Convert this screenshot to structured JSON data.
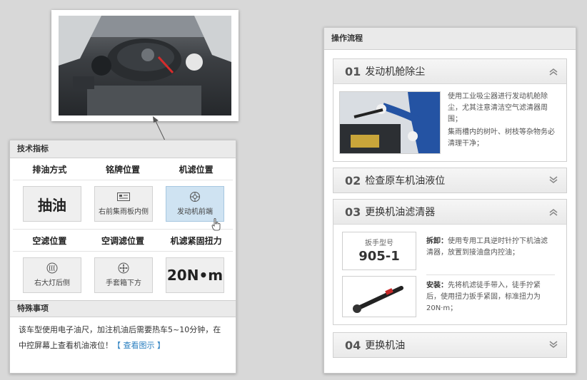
{
  "tech_panel": {
    "title": "技术指标",
    "row1_labels": [
      "排油方式",
      "铭牌位置",
      "机滤位置"
    ],
    "row1_tiles": [
      {
        "text": "抽油",
        "icon": ""
      },
      {
        "text": "右前集雨板内侧",
        "icon": "nameplate-icon"
      },
      {
        "text": "发动机前端",
        "icon": "engine-gear-icon"
      }
    ],
    "row2_labels": [
      "空滤位置",
      "空调滤位置",
      "机滤紧固扭力"
    ],
    "row2_tiles": [
      {
        "text": "右大灯后侧",
        "icon": "air-filter-icon"
      },
      {
        "text": "手套箱下方",
        "icon": "fan-icon"
      },
      {
        "text": "20N•m",
        "icon": ""
      }
    ],
    "special_title": "特殊事项",
    "special_text": "该车型使用电子油尺，加注机油后需要热车5~10分钟，在中控屏幕上查看机油液位！",
    "special_link": "【 查看图示 】"
  },
  "process_panel": {
    "title": "操作流程",
    "steps": [
      {
        "num": "01",
        "title": "发动机舱除尘",
        "expanded": true,
        "text1": "使用工业吸尘器进行发动机舱除尘，尤其注意清洁空气滤清器周围；",
        "text2": "集雨槽内的树叶、树枝等杂物务必清理干净；"
      },
      {
        "num": "02",
        "title": "检查原车机油液位",
        "expanded": false
      },
      {
        "num": "03",
        "title": "更换机油滤清器",
        "expanded": true,
        "wrench_label": "扳手型号",
        "wrench_model": "905-1",
        "remove_label": "拆卸：",
        "remove_text": "使用专用工具逆时针拧下机油滤清器，放置到接油盘内控油；",
        "install_label": "安装：",
        "install_text": "先将机滤徒手带入，徒手拧紧后，使用扭力扳手紧固，标准扭力为20N·m；"
      },
      {
        "num": "04",
        "title": "更换机油",
        "expanded": false
      }
    ]
  },
  "colors": {
    "link": "#2a7fc0",
    "active_tile": "#cfe3f2",
    "panel_header": "#eaeaea"
  }
}
